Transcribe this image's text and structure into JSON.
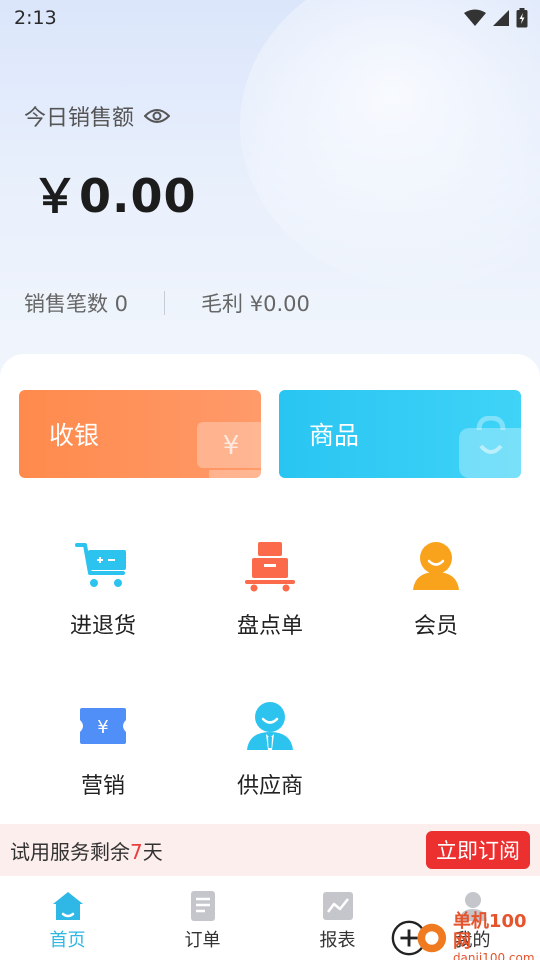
{
  "status_bar": {
    "time": "2:13"
  },
  "summary": {
    "sales_label": "今日销售额",
    "sales_amount": "￥0.00",
    "sales_count": "销售笔数 0",
    "gross_profit": "毛利 ¥0.00"
  },
  "quick_actions": {
    "cashier": "收银",
    "goods": "商品",
    "cashier_deco": "¥"
  },
  "menu": [
    {
      "label": "进退货"
    },
    {
      "label": "盘点单"
    },
    {
      "label": "会员"
    },
    {
      "label": "营销"
    },
    {
      "label": "供应商"
    }
  ],
  "trial": {
    "text_prefix": "试用服务剩余",
    "days": "7",
    "text_suffix": "天",
    "subscribe_label": "立即订阅"
  },
  "tabbar": [
    {
      "label": "首页",
      "active": true
    },
    {
      "label": "订单",
      "active": false
    },
    {
      "label": "报表",
      "active": false
    },
    {
      "label": "我的",
      "active": false
    }
  ],
  "watermark": {
    "name": "单机100网",
    "url": "danji100.com"
  },
  "colors": {
    "accent_blue": "#2fb7e6",
    "cashier_orange": "#ff8a4c",
    "goods_cyan": "#29c5f2",
    "alert_red": "#ec2f2f"
  }
}
